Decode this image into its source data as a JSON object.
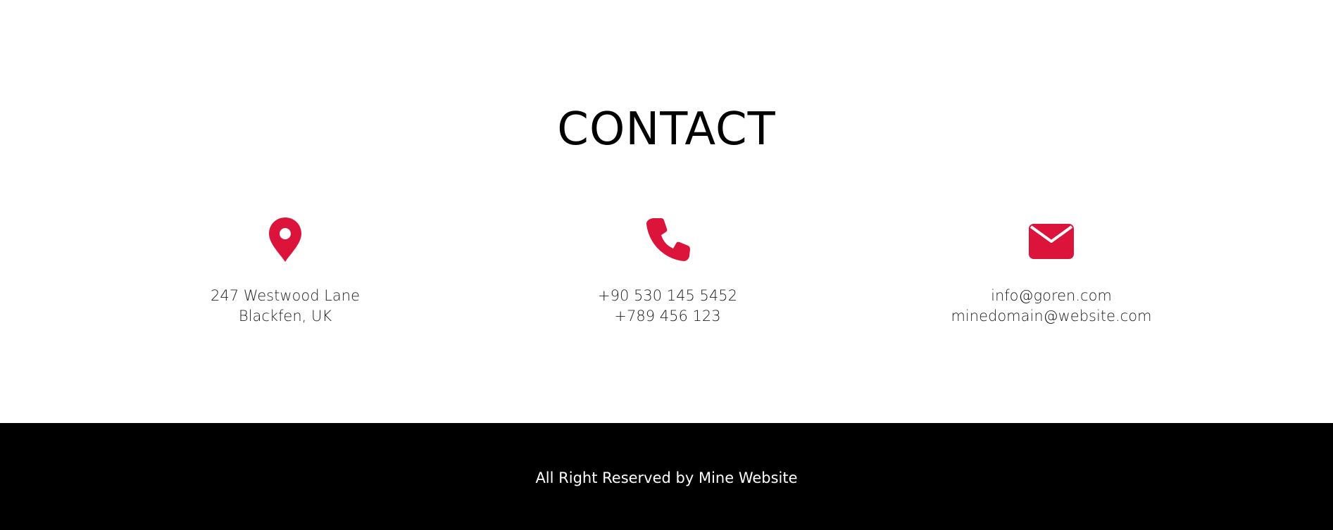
{
  "contact": {
    "title": "CONTACT",
    "accent_color": "#DC143C",
    "items": [
      {
        "icon": "map-pin-icon",
        "lines": [
          "247 Westwood Lane",
          "Blackfen, UK"
        ]
      },
      {
        "icon": "phone-icon",
        "lines": [
          "+90 530 145 5452",
          "+789 456 123"
        ]
      },
      {
        "icon": "envelope-icon",
        "lines": [
          "info@goren.com",
          "minedomain@website.com"
        ]
      }
    ]
  },
  "footer": {
    "text": "All Right Reserved by Mine Website",
    "background": "#000000"
  }
}
